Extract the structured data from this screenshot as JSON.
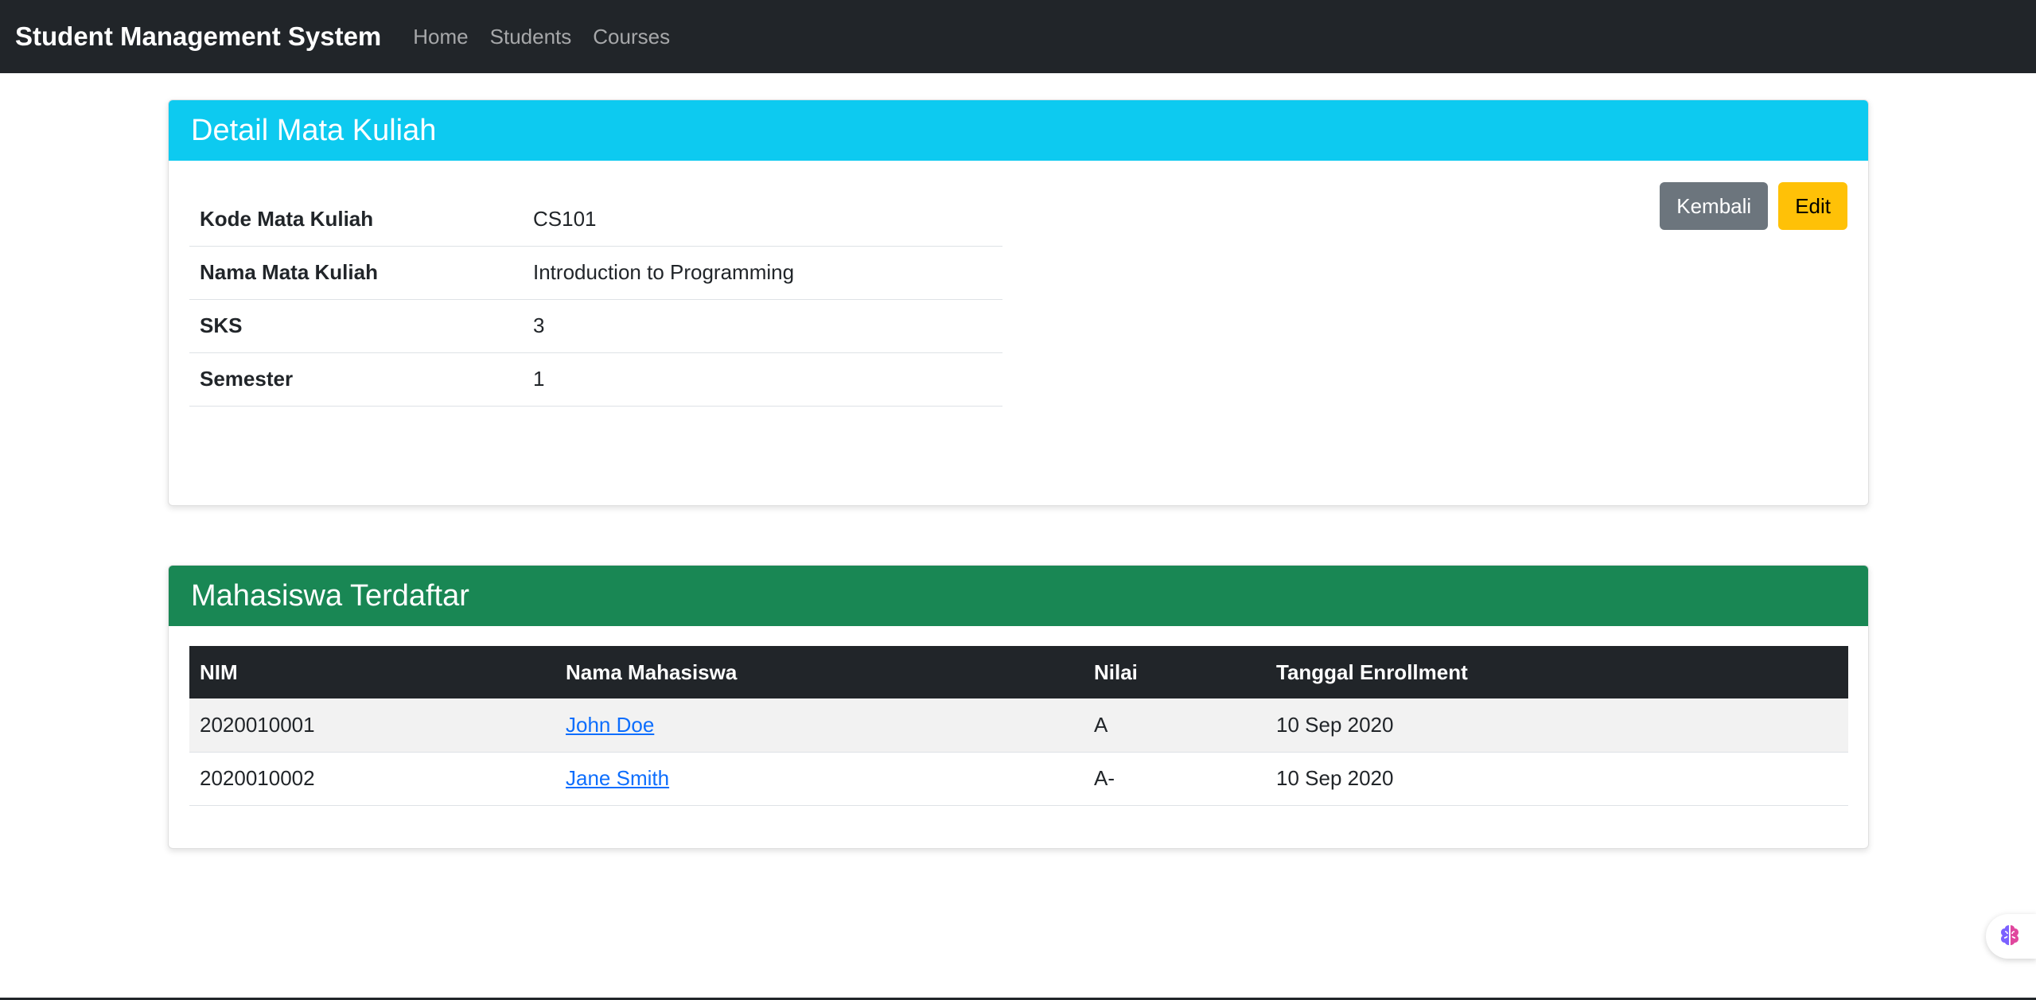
{
  "navbar": {
    "brand": "Student Management System",
    "links": [
      "Home",
      "Students",
      "Courses"
    ]
  },
  "course_card": {
    "header": "Detail Mata Kuliah",
    "back_label": "Kembali",
    "edit_label": "Edit",
    "fields": [
      {
        "label": "Kode Mata Kuliah",
        "value": "CS101"
      },
      {
        "label": "Nama Mata Kuliah",
        "value": "Introduction to Programming"
      },
      {
        "label": "SKS",
        "value": "3"
      },
      {
        "label": "Semester",
        "value": "1"
      }
    ]
  },
  "students_card": {
    "header": "Mahasiswa Terdaftar",
    "columns": [
      "NIM",
      "Nama Mahasiswa",
      "Nilai",
      "Tanggal Enrollment"
    ],
    "rows": [
      {
        "nim": "2020010001",
        "name": "John Doe",
        "grade": "A",
        "date": "10 Sep 2020"
      },
      {
        "nim": "2020010002",
        "name": "Jane Smith",
        "grade": "A-",
        "date": "10 Sep 2020"
      }
    ]
  },
  "colors": {
    "navbar": "#212529",
    "info": "#0dcaf0",
    "success": "#198754",
    "secondary": "#6c757d",
    "warning": "#ffc107",
    "link": "#0d6efd"
  },
  "icons": {
    "floating": "brain-icon"
  }
}
